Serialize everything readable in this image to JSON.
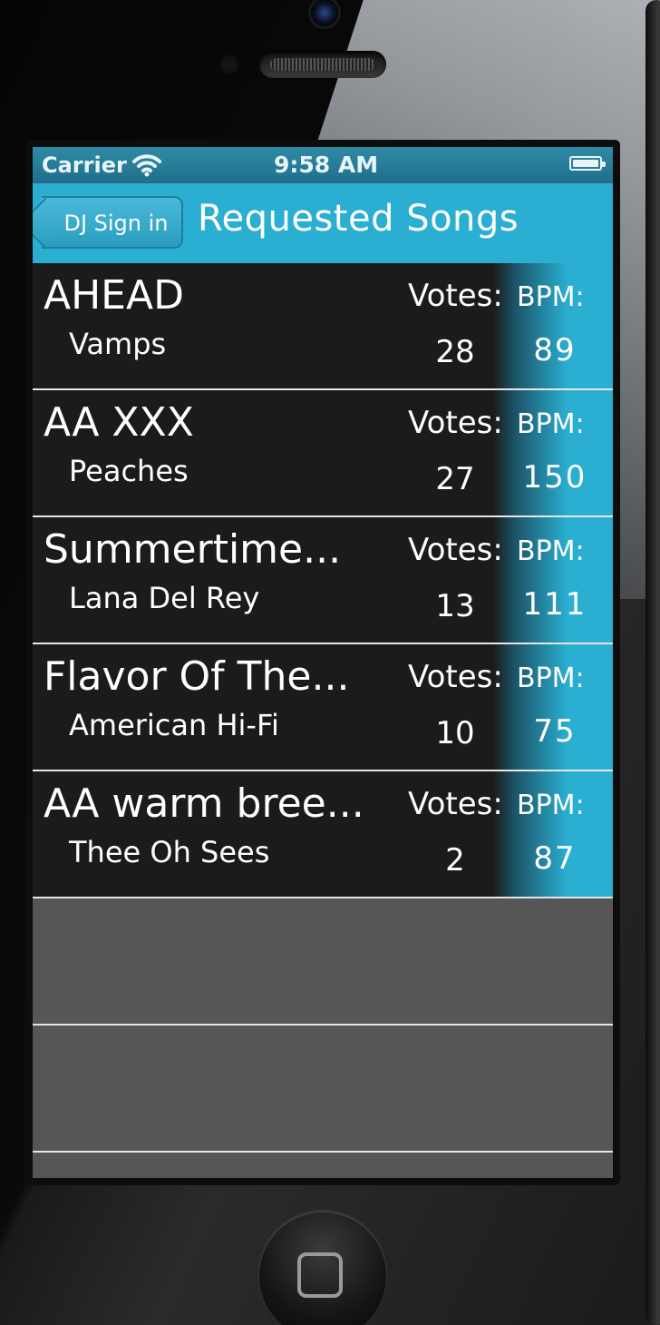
{
  "status_bar": {
    "carrier": "Carrier",
    "time": "9:58 AM"
  },
  "nav_bar": {
    "back_label": "DJ Sign in",
    "title": "Requested Songs"
  },
  "songs": [
    {
      "title": "AHEAD",
      "artist": "Vamps",
      "votes_label": "Votes:",
      "bpm_label": "BPM:",
      "votes": "28",
      "bpm": "89"
    },
    {
      "title": "AA XXX",
      "artist": "Peaches",
      "votes_label": "Votes:",
      "bpm_label": "BPM:",
      "votes": "27",
      "bpm": "150"
    },
    {
      "title": "Summertime...",
      "artist": "Lana Del Rey",
      "votes_label": "Votes:",
      "bpm_label": "BPM:",
      "votes": "13",
      "bpm": "111"
    },
    {
      "title": "Flavor Of The...",
      "artist": "American Hi-Fi",
      "votes_label": "Votes:",
      "bpm_label": "BPM:",
      "votes": "10",
      "bpm": "75"
    },
    {
      "title": "AA warm bree...",
      "artist": "Thee Oh Sees",
      "votes_label": "Votes:",
      "bpm_label": "BPM:",
      "votes": "2",
      "bpm": "87"
    }
  ],
  "icons": {
    "wifi": "wifi-icon",
    "battery": "battery-icon",
    "back": "back-chevron-icon",
    "home": "home-button-icon"
  },
  "colors": {
    "nav_accent": "#2aaed1",
    "status_bar": "#1f6f8a",
    "row_background": "#1b1b1b",
    "empty_background": "#565656"
  }
}
